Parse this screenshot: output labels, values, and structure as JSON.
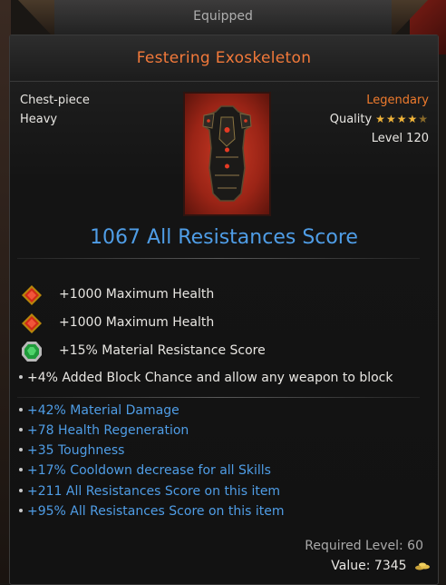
{
  "header": {
    "label": "Equipped"
  },
  "item": {
    "name": "Festering Exoskeleton",
    "slot": "Chest-piece",
    "weight": "Heavy",
    "rarity": "Legendary",
    "quality_label": "Quality",
    "quality_stars": 4.5,
    "level": "Level 120",
    "score": "1067 All Resistances Score",
    "rarity_color": "#f07b2d",
    "name_color": "#f2793a"
  },
  "gems": [
    {
      "icon": "red-gem-icon",
      "text": "+1000 Maximum Health"
    },
    {
      "icon": "red-gem-icon",
      "text": "+1000 Maximum Health"
    },
    {
      "icon": "green-gem-icon",
      "text": "+15% Material Resistance Score"
    }
  ],
  "special_affix": "+4% Added Block Chance and allow any weapon to block",
  "affixes": [
    "+42% Material Damage",
    "+78 Health Regeneration",
    "+35 Toughness",
    "+17% Cooldown decrease for all Skills",
    "+211 All Resistances Score on this item",
    "+95% All Resistances Score on this item"
  ],
  "footer": {
    "required_level": "Required Level: 60",
    "value": "Value: 7345"
  },
  "colors": {
    "affix_blue": "#4f9de6",
    "star_gold": "#f0b43a"
  }
}
